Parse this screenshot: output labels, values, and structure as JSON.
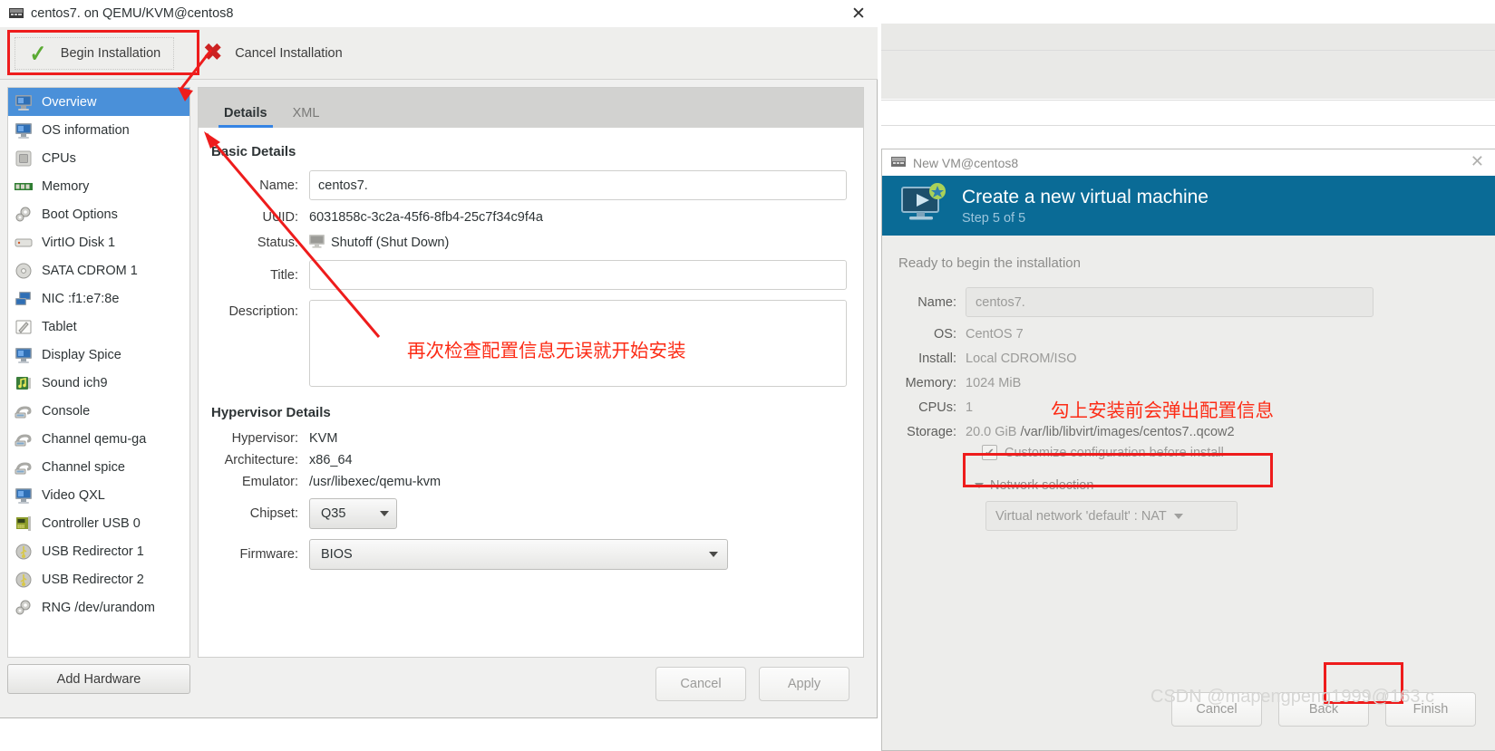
{
  "vm_window": {
    "title": "centos7. on QEMU/KVM@centos8",
    "title_icon": "vm-icon",
    "close_icon": "close-icon",
    "toolbar": {
      "begin_label": "Begin Installation",
      "begin_icon": "green-check-icon",
      "cancel_label": "Cancel Installation",
      "cancel_icon": "red-x-icon"
    },
    "sidebar": {
      "items": [
        {
          "label": "Overview",
          "icon": "monitor-icon",
          "selected": true
        },
        {
          "label": "OS information",
          "icon": "monitor-icon",
          "selected": false
        },
        {
          "label": "CPUs",
          "icon": "cpu-chip-icon",
          "selected": false
        },
        {
          "label": "Memory",
          "icon": "memory-stick-icon",
          "selected": false
        },
        {
          "label": "Boot Options",
          "icon": "gears-icon",
          "selected": false
        },
        {
          "label": "VirtIO Disk 1",
          "icon": "harddisk-icon",
          "selected": false
        },
        {
          "label": "SATA CDROM 1",
          "icon": "cdrom-icon",
          "selected": false
        },
        {
          "label": "NIC :f1:e7:8e",
          "icon": "network-icon",
          "selected": false
        },
        {
          "label": "Tablet",
          "icon": "tablet-pen-icon",
          "selected": false
        },
        {
          "label": "Display Spice",
          "icon": "monitor-icon",
          "selected": false
        },
        {
          "label": "Sound ich9",
          "icon": "sound-note-icon",
          "selected": false
        },
        {
          "label": "Console",
          "icon": "console-plug-icon",
          "selected": false
        },
        {
          "label": "Channel qemu-ga",
          "icon": "console-plug-icon",
          "selected": false
        },
        {
          "label": "Channel spice",
          "icon": "console-plug-icon",
          "selected": false
        },
        {
          "label": "Video QXL",
          "icon": "monitor-icon",
          "selected": false
        },
        {
          "label": "Controller USB 0",
          "icon": "controller-card-icon",
          "selected": false
        },
        {
          "label": "USB Redirector 1",
          "icon": "usb-icon",
          "selected": false
        },
        {
          "label": "USB Redirector 2",
          "icon": "usb-icon",
          "selected": false
        },
        {
          "label": "RNG /dev/urandom",
          "icon": "gears-icon",
          "selected": false
        }
      ],
      "add_hardware_label": "Add Hardware"
    },
    "tabs": [
      {
        "label": "Details",
        "active": true
      },
      {
        "label": "XML",
        "active": false
      }
    ],
    "basic_details": {
      "heading": "Basic Details",
      "name_label": "Name:",
      "name_value": "centos7.",
      "uuid_label": "UUID:",
      "uuid_value": "6031858c-3c2a-45f6-8fb4-25c7f34c9f4a",
      "status_label": "Status:",
      "status_value": "Shutoff (Shut Down)",
      "status_icon": "monitor-small-icon",
      "title_label": "Title:",
      "title_value": "",
      "description_label": "Description:",
      "description_value": ""
    },
    "hypervisor_details": {
      "heading": "Hypervisor Details",
      "hypervisor_label": "Hypervisor:",
      "hypervisor_value": "KVM",
      "architecture_label": "Architecture:",
      "architecture_value": "x86_64",
      "emulator_label": "Emulator:",
      "emulator_value": "/usr/libexec/qemu-kvm",
      "chipset_label": "Chipset:",
      "chipset_value": "Q35",
      "firmware_label": "Firmware:",
      "firmware_value": "BIOS"
    },
    "footer": {
      "cancel_label": "Cancel",
      "apply_label": "Apply"
    }
  },
  "new_vm_window": {
    "title": "New VM@centos8",
    "title_icon": "vm-icon",
    "close_icon": "close-icon",
    "banner": {
      "heading": "Create a new virtual machine",
      "step": "Step 5 of 5",
      "icon": "new-vm-monitor-icon",
      "color": "#0a6b96"
    },
    "ready_text": "Ready to begin the installation",
    "fields": {
      "name_label": "Name:",
      "name_value": "centos7.",
      "os_label": "OS:",
      "os_value": "CentOS 7",
      "install_label": "Install:",
      "install_value": "Local CDROM/ISO",
      "memory_label": "Memory:",
      "memory_value": "1024 MiB",
      "cpus_label": "CPUs:",
      "cpus_value": "1",
      "storage_label": "Storage:",
      "storage_value": "20.0 GiB",
      "storage_path": "/var/lib/libvirt/images/centos7..qcow2"
    },
    "customize": {
      "label": "Customize configuration before install",
      "checked": true,
      "check_icon": "checkmark-icon"
    },
    "network": {
      "section_label": "Network selection",
      "expander_icon": "triangle-down-icon",
      "selected": "Virtual network 'default' : NAT",
      "dropdown_icon": "caret-down-icon"
    },
    "footer": {
      "cancel_label": "Cancel",
      "back_label": "Back",
      "finish_label": "Finish"
    }
  },
  "annotations": {
    "note_details": "再次检查配置信息无误就开始安装",
    "note_customize": "勾上安装前会弹出配置信息",
    "highlight_color": "#ee1c1c",
    "arrow_color": "#ee1c1c"
  },
  "watermark": {
    "text": "CSDN @mapengpeng1999@163.c"
  }
}
